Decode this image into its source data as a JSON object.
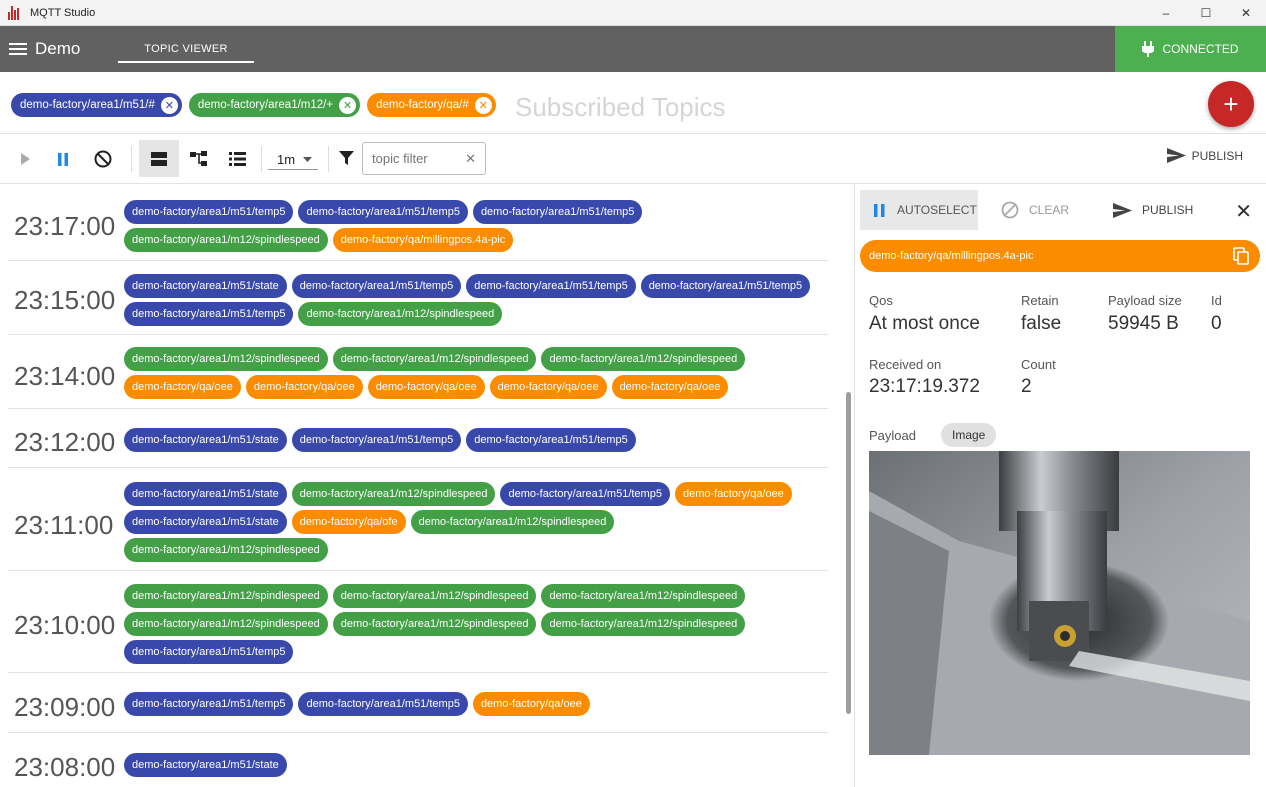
{
  "window": {
    "title": "MQTT Studio",
    "controls": [
      "–",
      "☐",
      "✕"
    ]
  },
  "appbar": {
    "title": "Demo",
    "tab": "TOPIC VIEWER",
    "status": "CONNECTED"
  },
  "subscriptions": {
    "placeholder": "Subscribed Topics",
    "items": [
      {
        "label": "demo-factory/area1/m51/#",
        "color": "#3949ab"
      },
      {
        "label": "demo-factory/area1/m12/+",
        "color": "#43a047"
      },
      {
        "label": "demo-factory/qa/#",
        "color": "#fb8c00"
      }
    ]
  },
  "toolbar": {
    "range": "1m",
    "filter_placeholder": "topic filter",
    "publish_label": "PUBLISH"
  },
  "timeline": [
    {
      "time": "23:17:00",
      "topics": [
        [
          "demo-factory/area1/m51/temp5",
          "blue"
        ],
        [
          "demo-factory/area1/m51/temp5",
          "blue"
        ],
        [
          "demo-factory/area1/m51/temp5",
          "blue"
        ],
        [
          "demo-factory/area1/m12/spindlespeed",
          "green"
        ],
        [
          "demo-factory/qa/millingpos.4a-pic",
          "orange"
        ]
      ]
    },
    {
      "time": "23:15:00",
      "topics": [
        [
          "demo-factory/area1/m51/state",
          "blue"
        ],
        [
          "demo-factory/area1/m51/temp5",
          "blue"
        ],
        [
          "demo-factory/area1/m51/temp5",
          "blue"
        ],
        [
          "demo-factory/area1/m51/temp5",
          "blue"
        ],
        [
          "demo-factory/area1/m51/temp5",
          "blue"
        ],
        [
          "demo-factory/area1/m12/spindlespeed",
          "green"
        ]
      ]
    },
    {
      "time": "23:14:00",
      "topics": [
        [
          "demo-factory/area1/m12/spindlespeed",
          "green"
        ],
        [
          "demo-factory/area1/m12/spindlespeed",
          "green"
        ],
        [
          "demo-factory/area1/m12/spindlespeed",
          "green"
        ],
        [
          "demo-factory/qa/oee",
          "orange"
        ],
        [
          "demo-factory/qa/oee",
          "orange"
        ],
        [
          "demo-factory/qa/oee",
          "orange"
        ],
        [
          "demo-factory/qa/oee",
          "orange"
        ],
        [
          "demo-factory/qa/oee",
          "orange"
        ]
      ]
    },
    {
      "time": "23:12:00",
      "topics": [
        [
          "demo-factory/area1/m51/state",
          "blue"
        ],
        [
          "demo-factory/area1/m51/temp5",
          "blue"
        ],
        [
          "demo-factory/area1/m51/temp5",
          "blue"
        ]
      ]
    },
    {
      "time": "23:11:00",
      "topics": [
        [
          "demo-factory/area1/m51/state",
          "blue"
        ],
        [
          "demo-factory/area1/m12/spindlespeed",
          "green"
        ],
        [
          "demo-factory/area1/m51/temp5",
          "blue"
        ],
        [
          "demo-factory/qa/oee",
          "orange"
        ],
        [
          "demo-factory/area1/m51/state",
          "blue"
        ],
        [
          "demo-factory/qa/ofe",
          "orange"
        ],
        [
          "demo-factory/area1/m12/spindlespeed",
          "green"
        ],
        [
          "demo-factory/area1/m12/spindlespeed",
          "green"
        ]
      ]
    },
    {
      "time": "23:10:00",
      "topics": [
        [
          "demo-factory/area1/m12/spindlespeed",
          "green"
        ],
        [
          "demo-factory/area1/m12/spindlespeed",
          "green"
        ],
        [
          "demo-factory/area1/m12/spindlespeed",
          "green"
        ],
        [
          "demo-factory/area1/m12/spindlespeed",
          "green"
        ],
        [
          "demo-factory/area1/m12/spindlespeed",
          "green"
        ],
        [
          "demo-factory/area1/m12/spindlespeed",
          "green"
        ],
        [
          "demo-factory/area1/m51/temp5",
          "blue"
        ]
      ]
    },
    {
      "time": "23:09:00",
      "topics": [
        [
          "demo-factory/area1/m51/temp5",
          "blue"
        ],
        [
          "demo-factory/area1/m51/temp5",
          "blue"
        ],
        [
          "demo-factory/qa/oee",
          "orange"
        ]
      ]
    },
    {
      "time": "23:08:00",
      "topics": [
        [
          "demo-factory/area1/m51/state",
          "blue"
        ]
      ]
    }
  ],
  "detail": {
    "autoselect": "AUTOSELECT",
    "clear": "CLEAR",
    "publish": "PUBLISH",
    "topic": "demo-factory/qa/millingpos.4a-pic",
    "qos_label": "Qos",
    "qos": "At most once",
    "retain_label": "Retain",
    "retain": "false",
    "size_label": "Payload size",
    "size": "59945 B",
    "id_label": "Id",
    "id": "0",
    "received_label": "Received on",
    "received": "23:17:19.372",
    "count_label": "Count",
    "count": "2",
    "payload_label": "Payload",
    "payload_type": "Image"
  }
}
